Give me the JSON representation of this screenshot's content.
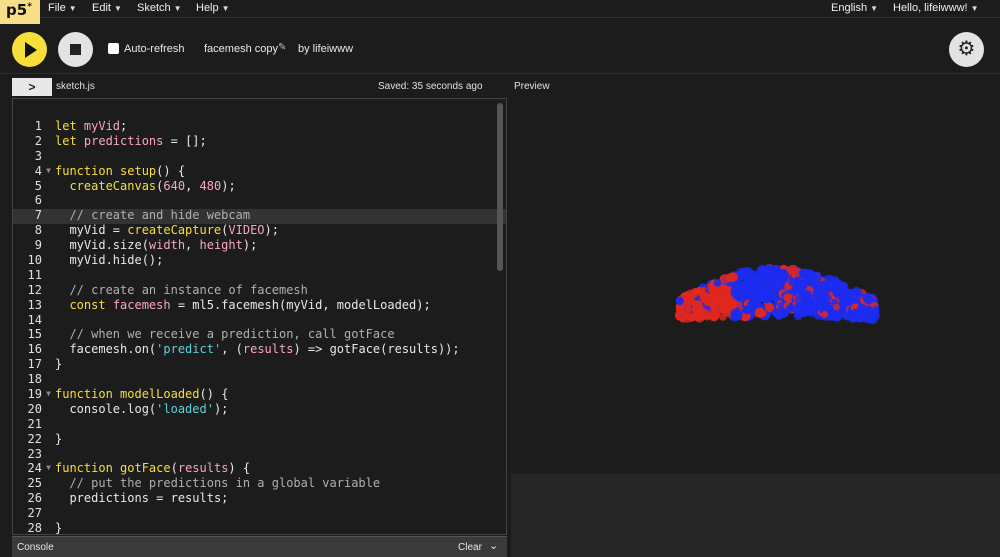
{
  "nav": {
    "logo": "p5",
    "logo_mark": "*",
    "menus": [
      "File",
      "Edit",
      "Sketch",
      "Help"
    ],
    "language": "English",
    "user_greeting": "Hello, lifeiwww!"
  },
  "toolbar": {
    "auto_refresh_label": "Auto-refresh",
    "auto_refresh_checked": false,
    "project_name": "facemesh copy",
    "by_label": "by lifeiwww"
  },
  "editor": {
    "file_name": "sketch.js",
    "saved_status": "Saved: 35 seconds ago",
    "preview_label": "Preview",
    "highlighted_line": 7,
    "lines": [
      {
        "n": "1",
        "fold": "",
        "tokens": [
          [
            "kw",
            "let "
          ],
          [
            "pl",
            "myVid"
          ],
          [
            "txt",
            ";"
          ]
        ]
      },
      {
        "n": "2",
        "fold": "",
        "tokens": [
          [
            "kw",
            "let "
          ],
          [
            "pl",
            "predictions"
          ],
          [
            "txt",
            " = [];"
          ]
        ]
      },
      {
        "n": "3",
        "fold": "",
        "tokens": []
      },
      {
        "n": "4",
        "fold": "▼",
        "tokens": [
          [
            "kw",
            "function "
          ],
          [
            "fn",
            "setup"
          ],
          [
            "txt",
            "() {"
          ]
        ]
      },
      {
        "n": "5",
        "fold": "",
        "tokens": [
          [
            "txt",
            "  "
          ],
          [
            "fn",
            "createCanvas"
          ],
          [
            "txt",
            "("
          ],
          [
            "pl",
            "640"
          ],
          [
            "txt",
            ", "
          ],
          [
            "pl",
            "480"
          ],
          [
            "txt",
            ");"
          ]
        ]
      },
      {
        "n": "6",
        "fold": "",
        "tokens": []
      },
      {
        "n": "7",
        "fold": "",
        "tokens": [
          [
            "cm",
            "  // create and hide webcam"
          ]
        ]
      },
      {
        "n": "8",
        "fold": "",
        "tokens": [
          [
            "txt",
            "  myVid = "
          ],
          [
            "fn",
            "createCapture"
          ],
          [
            "txt",
            "("
          ],
          [
            "pl",
            "VIDEO"
          ],
          [
            "txt",
            ");"
          ]
        ]
      },
      {
        "n": "9",
        "fold": "",
        "tokens": [
          [
            "txt",
            "  myVid.size("
          ],
          [
            "pl",
            "width"
          ],
          [
            "txt",
            ", "
          ],
          [
            "pl",
            "height"
          ],
          [
            "txt",
            ");"
          ]
        ]
      },
      {
        "n": "10",
        "fold": "",
        "tokens": [
          [
            "txt",
            "  myVid.hide();"
          ]
        ]
      },
      {
        "n": "11",
        "fold": "",
        "tokens": []
      },
      {
        "n": "12",
        "fold": "",
        "tokens": [
          [
            "cm",
            "  // create an instance of facemesh"
          ]
        ]
      },
      {
        "n": "13",
        "fold": "",
        "tokens": [
          [
            "txt",
            "  "
          ],
          [
            "kw",
            "const "
          ],
          [
            "pl",
            "facemesh"
          ],
          [
            "txt",
            " = ml5.facemesh(myVid, modelLoaded);"
          ]
        ]
      },
      {
        "n": "14",
        "fold": "",
        "tokens": []
      },
      {
        "n": "15",
        "fold": "",
        "tokens": [
          [
            "cm",
            "  // when we receive a prediction, call gotFace"
          ]
        ]
      },
      {
        "n": "16",
        "fold": "",
        "tokens": [
          [
            "txt",
            "  facemesh.on("
          ],
          [
            "st",
            "'predict'"
          ],
          [
            "txt",
            ", ("
          ],
          [
            "pl",
            "results"
          ],
          [
            "txt",
            ") => gotFace(results));"
          ]
        ]
      },
      {
        "n": "17",
        "fold": "",
        "tokens": [
          [
            "txt",
            "}"
          ]
        ]
      },
      {
        "n": "18",
        "fold": "",
        "tokens": []
      },
      {
        "n": "19",
        "fold": "▼",
        "tokens": [
          [
            "kw",
            "function "
          ],
          [
            "fn",
            "modelLoaded"
          ],
          [
            "txt",
            "() {"
          ]
        ]
      },
      {
        "n": "20",
        "fold": "",
        "tokens": [
          [
            "txt",
            "  console.log("
          ],
          [
            "st",
            "'loaded'"
          ],
          [
            "txt",
            ");"
          ]
        ]
      },
      {
        "n": "21",
        "fold": "",
        "tokens": []
      },
      {
        "n": "22",
        "fold": "",
        "tokens": [
          [
            "txt",
            "}"
          ]
        ]
      },
      {
        "n": "23",
        "fold": "",
        "tokens": []
      },
      {
        "n": "24",
        "fold": "▼",
        "tokens": [
          [
            "kw",
            "function "
          ],
          [
            "fn",
            "gotFace"
          ],
          [
            "txt",
            "("
          ],
          [
            "pl",
            "results"
          ],
          [
            "txt",
            ") {"
          ]
        ]
      },
      {
        "n": "25",
        "fold": "",
        "tokens": [
          [
            "cm",
            "  // put the predictions in a global variable"
          ]
        ]
      },
      {
        "n": "26",
        "fold": "",
        "tokens": [
          [
            "txt",
            "  predictions = results;"
          ]
        ]
      },
      {
        "n": "27",
        "fold": "",
        "tokens": []
      },
      {
        "n": "28",
        "fold": "",
        "tokens": [
          [
            "txt",
            "}"
          ]
        ]
      }
    ]
  },
  "console": {
    "label": "Console",
    "clear_label": "Clear"
  },
  "colors": {
    "accent_yellow": "#f7df3a",
    "point_red": "#e0281e",
    "point_blue": "#1c2cf0"
  }
}
